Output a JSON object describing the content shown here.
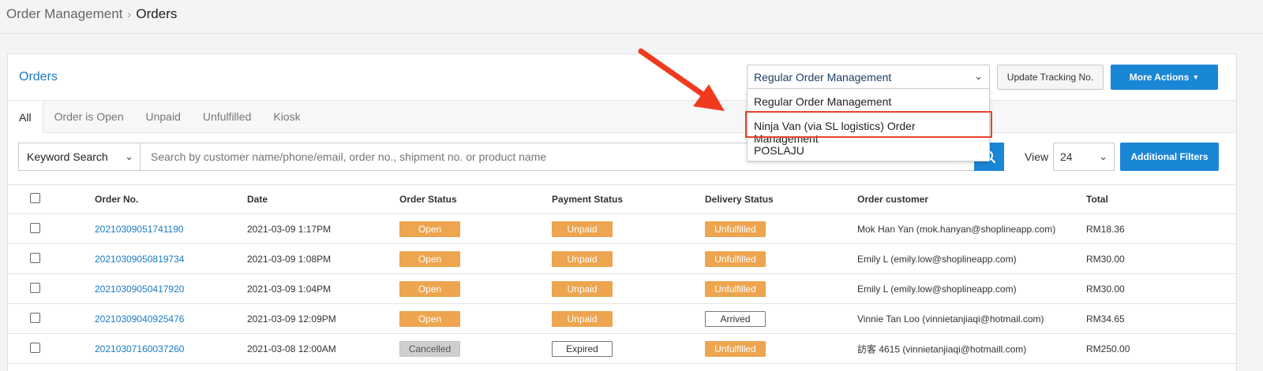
{
  "breadcrumb": {
    "parent": "Order Management",
    "separator": "›",
    "current": "Orders"
  },
  "card": {
    "title": "Orders"
  },
  "management_select": {
    "value": "Regular Order Management",
    "options": [
      "Regular Order Management",
      "Ninja Van (via SL logistics) Order Management",
      "POSLAJU"
    ]
  },
  "buttons": {
    "update_tracking": "Update Tracking No.",
    "more_actions": "More Actions",
    "additional_filters": "Additional Filters"
  },
  "tabs": [
    "All",
    "Order is Open",
    "Unpaid",
    "Unfulfilled",
    "Kiosk"
  ],
  "search": {
    "mode": "Keyword Search",
    "placeholder": "Search by customer name/phone/email, order no., shipment no. or product name"
  },
  "view": {
    "label": "View",
    "value": "24"
  },
  "table": {
    "headers": [
      "Order No.",
      "Date",
      "Order Status",
      "Payment Status",
      "Delivery Status",
      "Order customer",
      "Total"
    ],
    "rows": [
      {
        "order_no": "20210309051741190",
        "date": "2021-03-09 1:17PM",
        "order_status": "Open",
        "payment_status": "Unpaid",
        "delivery_status": "Unfulfilled",
        "customer": "Mok Han Yan (mok.hanyan@shoplineapp.com)",
        "total": "RM18.36"
      },
      {
        "order_no": "20210309050819734",
        "date": "2021-03-09 1:08PM",
        "order_status": "Open",
        "payment_status": "Unpaid",
        "delivery_status": "Unfulfilled",
        "customer": "Emily L (emily.low@shoplineapp.com)",
        "total": "RM30.00"
      },
      {
        "order_no": "20210309050417920",
        "date": "2021-03-09 1:04PM",
        "order_status": "Open",
        "payment_status": "Unpaid",
        "delivery_status": "Unfulfilled",
        "customer": "Emily L (emily.low@shoplineapp.com)",
        "total": "RM30.00"
      },
      {
        "order_no": "20210309040925476",
        "date": "2021-03-09 12:09PM",
        "order_status": "Open",
        "payment_status": "Unpaid",
        "delivery_status": "Arrived",
        "customer": "Vinnie Tan Loo (vinnietanjiaqi@hotmail.com)",
        "total": "RM34.65"
      },
      {
        "order_no": "20210307160037260",
        "date": "2021-03-08 12:00AM",
        "order_status": "Cancelled",
        "payment_status": "Expired",
        "delivery_status": "Unfulfilled",
        "customer": "訪客 4615 (vinnietanjiaqi@hotmaill.com)",
        "total": "RM250.00"
      }
    ]
  },
  "colors": {
    "accent": "#1a86d6",
    "link": "#1b7ac3",
    "status_orange": "#eda54f",
    "status_gray": "#cfcfcf",
    "highlight": "#e8402c"
  }
}
